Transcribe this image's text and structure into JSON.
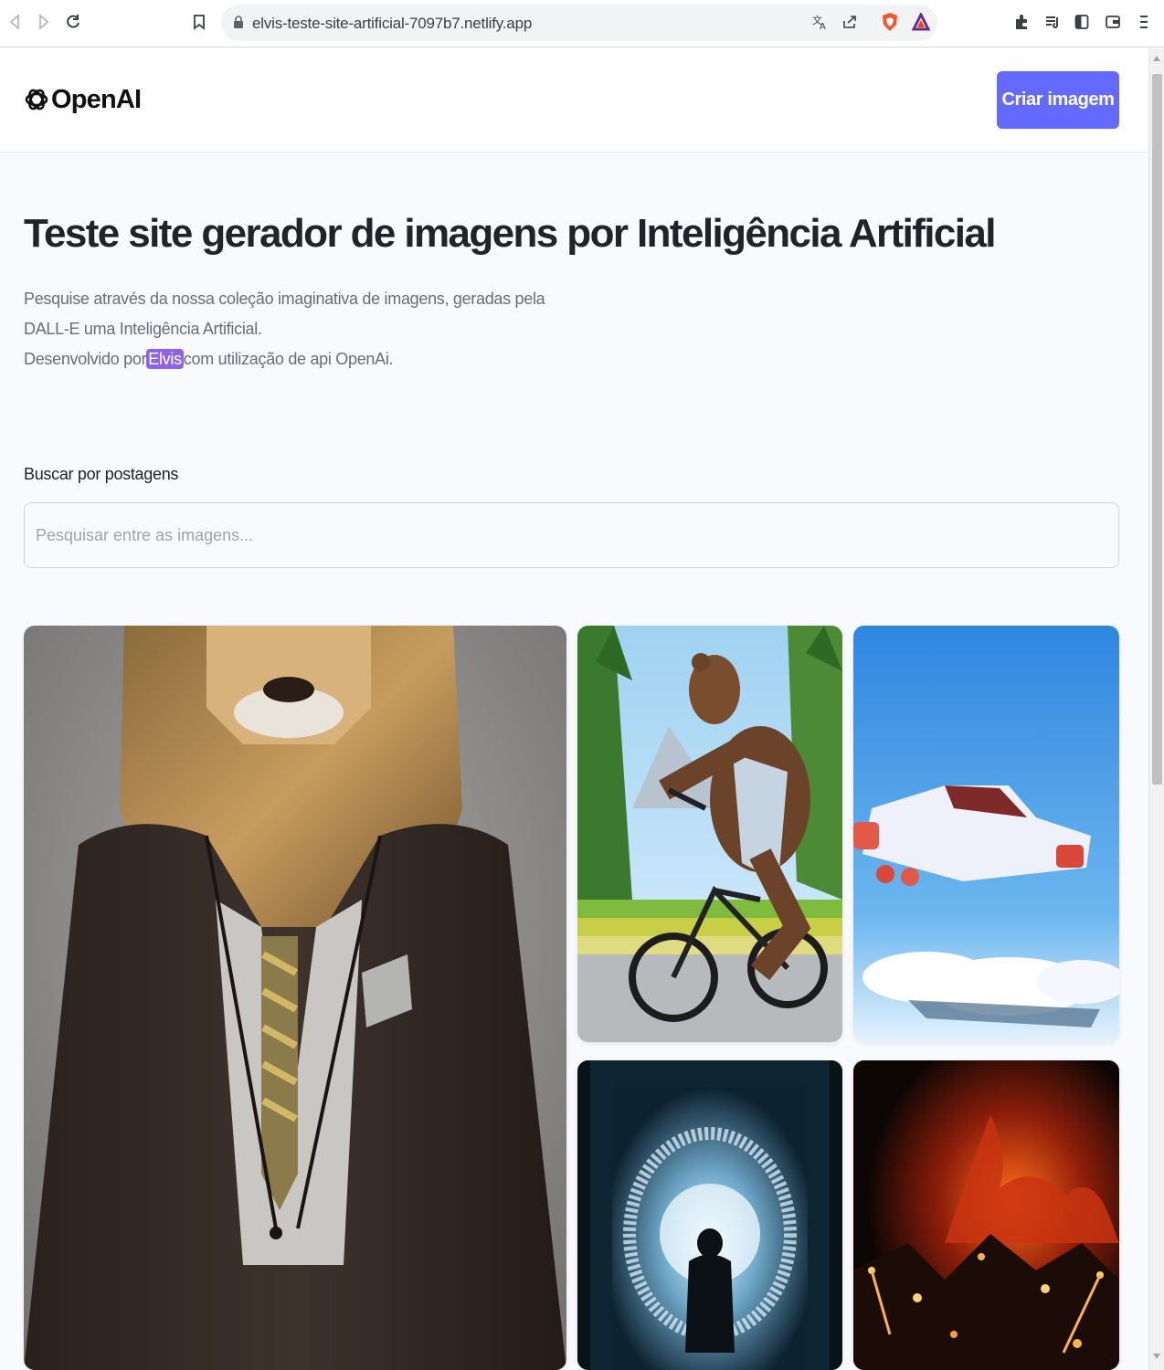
{
  "browser": {
    "url": "elvis-teste-site-artificial-7097b7.netlify.app"
  },
  "header": {
    "logo_text": "OpenAI",
    "create_button_label": "Criar imagem",
    "accent_color": "#6469ff"
  },
  "hero": {
    "title": "Teste site gerador de imagens por Inteligência Artificial",
    "description_line1": "Pesquise através da nossa coleção imaginativa de imagens, geradas pela",
    "description_line2": "DALL-E uma Inteligência Artificial.",
    "description_line3_prefix": "Desenvolvido por",
    "description_line3_highlight": "Elvis",
    "description_line3_suffix": "com utilização de api OpenAi."
  },
  "search": {
    "label": "Buscar por postagens",
    "placeholder": "Pesquisar entre as imagens...",
    "value": ""
  },
  "gallery": {
    "images": [
      {
        "subject": "lion in suit"
      },
      {
        "subject": "bear riding bicycle"
      },
      {
        "subject": "flying car"
      },
      {
        "subject": "person in portal"
      },
      {
        "subject": "fire at night"
      }
    ]
  }
}
